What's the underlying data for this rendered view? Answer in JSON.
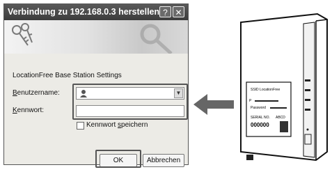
{
  "dialog": {
    "title": "Verbindung zu 192.168.0.3 herstellen",
    "help_label": "?",
    "close_label": "✕",
    "subtitle": "LocationFree Base Station Settings",
    "username_label_accel": "B",
    "username_label_rest": "enutzername:",
    "password_label_accel": "K",
    "password_label_rest": "ennwort:",
    "remember_label_pre": "Kennwort ",
    "remember_label_accel": "s",
    "remember_label_post": "peichern",
    "ok_label": "OK",
    "cancel_label": "Abbrechen",
    "username_value": "",
    "password_value": ""
  },
  "device": {
    "sticker_line1": "SSID LocationFree",
    "sticker_line2": "P",
    "sticker_line3": "Password",
    "sticker_line4": "SERIAL NO.",
    "sticker_line5": "ABCD",
    "sticker_serial": "000000"
  },
  "colors": {
    "titlebar": "#444444",
    "dialog_bg": "#ecebe6",
    "highlight": "#555555",
    "arrow": "#666666"
  },
  "icons": [
    "keys-icon",
    "help-icon",
    "close-icon",
    "user-icon",
    "dropdown-arrow-icon",
    "arrow-left-icon",
    "device-illustration"
  ]
}
